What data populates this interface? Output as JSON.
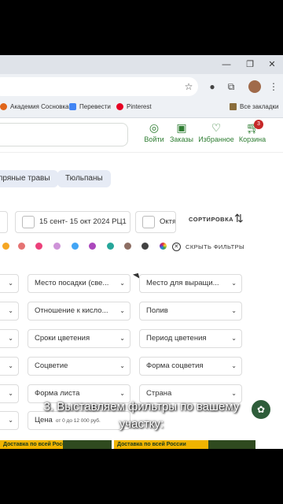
{
  "browser": {
    "bookmarks": [
      {
        "label": "Академия Сосновка",
        "color": "#e0651a"
      },
      {
        "label": "Перевести",
        "color": "#4285f4"
      },
      {
        "label": "Pinterest",
        "color": "#e60023"
      }
    ],
    "all_bookmarks_label": "Все закладки"
  },
  "header": {
    "login_label": "Войти",
    "orders_label": "Заказы",
    "favorites_label": "Избранное",
    "cart_label": "Корзина",
    "cart_count": "3",
    "accent_color": "#2e7d32"
  },
  "chips": [
    "пряные травы",
    "Тюльпаны"
  ],
  "dates": {
    "range_label": "15 сент- 15 окт 2024 РЦ1",
    "partial_label": "Октя"
  },
  "sort_label": "СОРТИРОВКА",
  "hide_filters_label": "СКРЫТЬ ФИЛЬТРЫ",
  "color_dots": [
    "#f5a623",
    "#e57373",
    "#ec407a",
    "#ce93d8",
    "#42a5f5",
    "#ab47bc",
    "#26a69a",
    "#8d6e63",
    "#424242",
    "multicolor"
  ],
  "filters": {
    "row1": [
      "Место посадки (све...",
      "Место для выращи..."
    ],
    "row2": [
      "Отношение к кисло...",
      "Полив"
    ],
    "row3": [
      "Сроки цветения",
      "Период цветения"
    ],
    "row4": [
      "Соцветие",
      "Форма соцветия"
    ],
    "row5": [
      "Форма листа",
      "Страна"
    ],
    "price_label": "Цена",
    "price_hint": "от 0 до 12 000 руб."
  },
  "banners": [
    "Доставка по всей России",
    "Доставка по всей России"
  ],
  "subtitle": "3. Выставляем фильтры по вашему участку:"
}
